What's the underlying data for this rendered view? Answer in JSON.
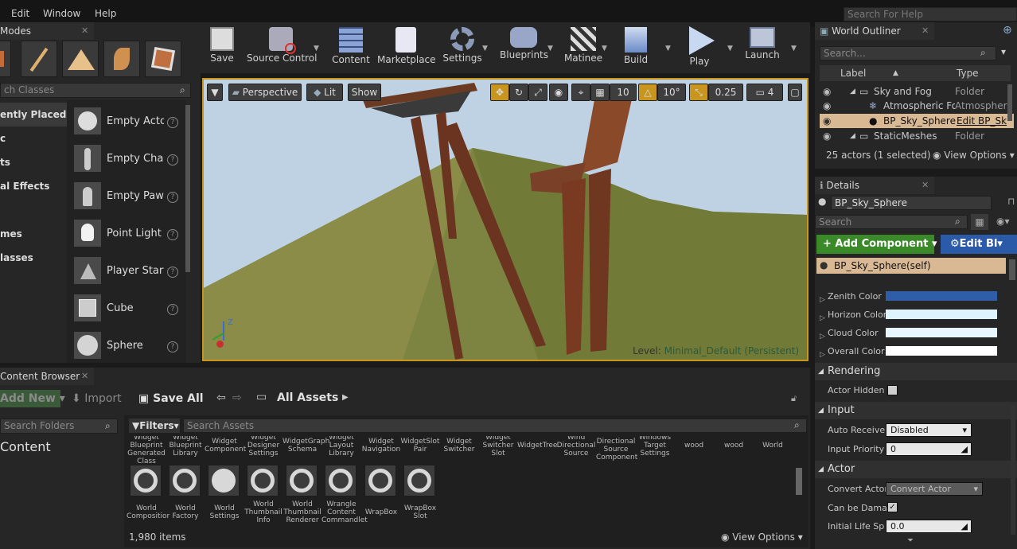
{
  "menu": {
    "items": [
      "Edit",
      "Window",
      "Help"
    ],
    "search_placeholder": "Search For Help"
  },
  "modes": {
    "title": "Modes",
    "search_placeholder": "ch Classes",
    "categories": [
      "ently Placed",
      "c",
      "ts",
      "al Effects",
      "mes",
      "lasses"
    ],
    "items": [
      "Empty Actor",
      "Empty Chara",
      "Empty Pawn",
      "Point Light",
      "Player Start",
      "Cube",
      "Sphere"
    ]
  },
  "toolbar": {
    "buttons": [
      "Save",
      "Source Control",
      "Content",
      "Marketplace",
      "Settings",
      "Blueprints",
      "Matinee",
      "Build",
      "Play",
      "Launch"
    ]
  },
  "viewport": {
    "perspective": "Perspective",
    "lit": "Lit",
    "show": "Show",
    "grid_snap": "10",
    "rot_snap": "10°",
    "scale_snap": "0.25",
    "camera_speed": "4",
    "level_label": "Level:",
    "level_name": "Minimal_Default (Persistent)"
  },
  "outliner": {
    "title": "World Outliner",
    "search_placeholder": "Search...",
    "col_label": "Label",
    "col_type": "Type",
    "rows": [
      {
        "label": "Sky and Fog",
        "type": "Folder"
      },
      {
        "label": "Atmospheric Fog",
        "type": "Atmospheri"
      },
      {
        "label": "BP_Sky_Sphere",
        "type": "Edit BP_Sk"
      },
      {
        "label": "StaticMeshes",
        "type": "Folder"
      }
    ],
    "actor_count": "25 actors (1 selected)",
    "view_options": "View Options"
  },
  "details": {
    "title": "Details",
    "name_value": "BP_Sky_Sphere",
    "search_placeholder": "Search",
    "add_component": "Add Component",
    "edit_bp": "Edit Bl",
    "self_item": "BP_Sky_Sphere(self)",
    "color_props": [
      {
        "label": "Zenith Color",
        "color": "#2f5ea8"
      },
      {
        "label": "Horizon Color",
        "color": "#dff3ff"
      },
      {
        "label": "Cloud Color",
        "color": "#e8f6ff"
      },
      {
        "label": "Overall Color",
        "color": "#ffffff"
      }
    ],
    "rendering_title": "Rendering",
    "actor_hidden": "Actor Hidden",
    "input_title": "Input",
    "auto_receive": "Auto Receive",
    "auto_receive_value": "Disabled",
    "input_priority": "Input Priority",
    "input_priority_value": "0",
    "actor_title": "Actor",
    "convert_actor": "Convert Actor",
    "convert_actor_value": "Convert Actor",
    "can_be_damaged": "Can be Damag",
    "initial_life": "Initial Life Sp",
    "initial_life_value": "0.0"
  },
  "content_browser": {
    "title": "Content Browser",
    "add_new": "Add New",
    "import": "Import",
    "save_all": "Save All",
    "path": "All Assets",
    "search_folders": "Search Folders",
    "filters": "Filters",
    "search_assets": "Search Assets",
    "root_folder": "Content",
    "top_labels": [
      "Widget Blueprint Generated Class",
      "Widget Blueprint Library",
      "Widget Component",
      "Widget Designer Settings",
      "WidgetGraph Schema",
      "Widget Layout Library",
      "Widget Navigation",
      "WidgetSlot Pair",
      "Widget Switcher",
      "Widget Switcher Slot",
      "WidgetTree",
      "Wind Directional Source",
      "Wind Directional Source Component",
      "Windows Target Settings",
      "wood",
      "wood",
      "World"
    ],
    "bottom_labels": [
      "World Compositior",
      "World Factory",
      "World Settings",
      "World Thumbnail Info",
      "World Thumbnail Renderer",
      "Wrangle Content Commandlet",
      "WrapBox",
      "WrapBox Slot"
    ],
    "item_count": "1,980 items",
    "view_options": "View Options"
  }
}
